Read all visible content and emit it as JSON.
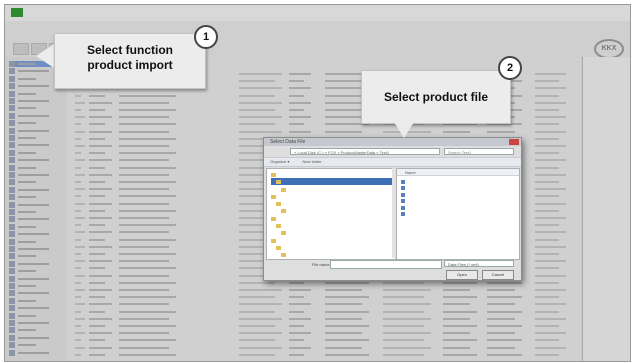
{
  "callouts": [
    {
      "number": "1",
      "line1": "Select function",
      "line2": "product import"
    },
    {
      "number": "2",
      "text": "Select product file"
    }
  ],
  "app": {
    "logo": "KKX"
  },
  "file_dialog": {
    "title": "Select Data File",
    "address": "» Local Disk (C:) » FOX » ProductMasterData » Test1",
    "search_placeholder": "Search Test1",
    "toolbar": [
      "Organize ▾",
      "New folder"
    ],
    "files_header": "Name",
    "file_name_label": "File name:",
    "filter": "Data Files (*.xml)",
    "open_label": "Open",
    "cancel_label": "Cancel"
  }
}
